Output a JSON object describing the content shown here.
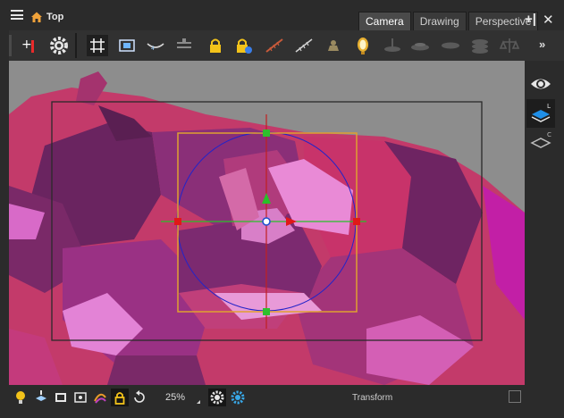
{
  "view": {
    "title": "Top",
    "tabs": [
      {
        "label": "Camera",
        "active": true
      },
      {
        "label": "Drawing",
        "active": false
      },
      {
        "label": "Perspective",
        "active": false
      }
    ],
    "add_view_glyph": "+|",
    "close_glyph": "✕"
  },
  "toolbar": {
    "more_glyph": "»",
    "tools": [
      "reset-view-icon",
      "settings-gear-icon",
      "grid-icon",
      "safe-area-icon",
      "onion-skin-icon",
      "light-table-icon",
      "lock-icon",
      "lock-plus-icon",
      "pencil-mesh-icon",
      "brush-mesh-icon",
      "stamp-icon",
      "lamp-icon",
      "ground-layer-icon",
      "disk-layer-icon",
      "flat-layer-icon",
      "stack-layer-icon",
      "scale-icon"
    ]
  },
  "right_toolbar": {
    "tools": [
      "eye-icon",
      "current-layer-icon",
      "layer-stack-icon"
    ]
  },
  "status": {
    "zoom": "25%",
    "mode": "Transform"
  },
  "colors": {
    "stage_bg": "#8d8d8d",
    "accent_orange": "#e0a030",
    "handle_green": "#2ec02e",
    "handle_red": "#e01818",
    "pivot_blue": "#2050d0"
  }
}
